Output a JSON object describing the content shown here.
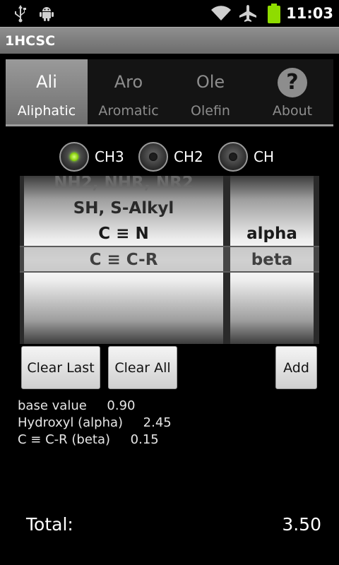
{
  "status_bar": {
    "time": "11:03",
    "icons": [
      "usb-icon",
      "android-debug-icon",
      "wifi-icon",
      "airplane-icon",
      "battery-icon"
    ]
  },
  "app": {
    "title": "1HCSC"
  },
  "tabs": [
    {
      "icon_text": "Ali",
      "label": "Aliphatic",
      "active": true
    },
    {
      "icon_text": "Aro",
      "label": "Aromatic",
      "active": false
    },
    {
      "icon_text": "Ole",
      "label": "Olefin",
      "active": false
    },
    {
      "icon_text": "?",
      "label": "About",
      "active": false
    }
  ],
  "radios": [
    {
      "label": "CH3",
      "checked": true
    },
    {
      "label": "CH2",
      "checked": false
    },
    {
      "label": "CH",
      "checked": false
    }
  ],
  "picker": {
    "left_items": [
      "NH2, NHR, NR2",
      "SH, S-Alkyl",
      "C ≡ N",
      "C ≡ C-R"
    ],
    "left_selected": "C ≡ C-R",
    "right_items": [
      "alpha",
      "beta"
    ],
    "right_selected": "beta"
  },
  "buttons": {
    "clear_last": "Clear Last",
    "clear_all": "Clear All",
    "add": "Add"
  },
  "summary": [
    {
      "label": "base value",
      "value": "0.90"
    },
    {
      "label": "Hydroxyl (alpha)",
      "value": "2.45"
    },
    {
      "label": "C ≡ C-R (beta)",
      "value": "0.15"
    }
  ],
  "total": {
    "label": "Total:",
    "value": "3.50"
  },
  "colors": {
    "background": "#000000",
    "title_bar": "#7d7d7d",
    "radio_active": "#7dc800",
    "battery": "#8fdc00"
  }
}
